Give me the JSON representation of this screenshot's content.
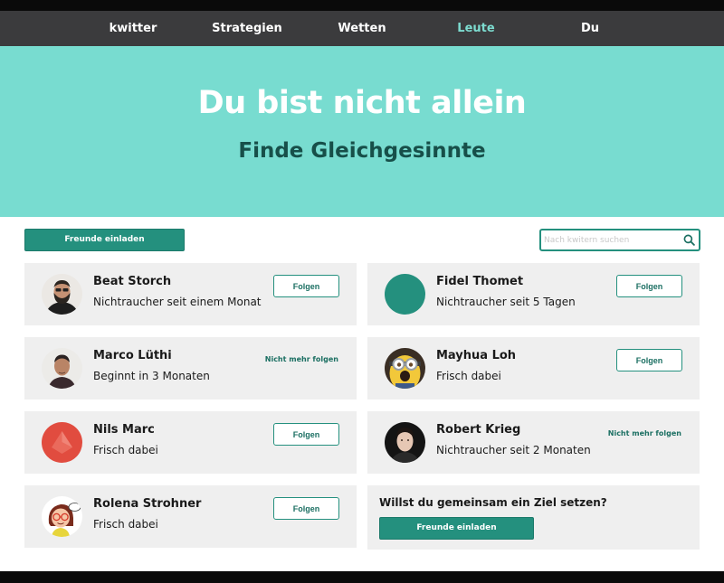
{
  "nav": {
    "items": [
      {
        "label": "kwitter"
      },
      {
        "label": "Strategien"
      },
      {
        "label": "Wetten"
      },
      {
        "label": "Leute",
        "active": true
      },
      {
        "label": "Du"
      }
    ]
  },
  "hero": {
    "title": "Du bist nicht allein",
    "subtitle": "Finde Gleichgesinnte"
  },
  "toolbar": {
    "invite_label": "Freunde einladen",
    "search_placeholder": "Nach kwitern suchen"
  },
  "people": [
    {
      "name": "Beat Storch",
      "status": "Nichtraucher seit einem Monat",
      "action": "Folgen",
      "following": false,
      "avatar": "beard-man-photo"
    },
    {
      "name": "Fidel Thomet",
      "status": "Nichtraucher seit 5 Tagen",
      "action": "Folgen",
      "following": false,
      "avatar": "teal-circle"
    },
    {
      "name": "Marco Lüthi",
      "status": "Beginnt in 3 Monaten",
      "action": "Nicht mehr folgen",
      "following": true,
      "avatar": "man-photo"
    },
    {
      "name": "Mayhua Loh",
      "status": "Frisch dabei",
      "action": "Folgen",
      "following": false,
      "avatar": "minion-photo"
    },
    {
      "name": "Nils Marc",
      "status": "Frisch dabei",
      "action": "Folgen",
      "following": false,
      "avatar": "red-logo-circle"
    },
    {
      "name": "Robert Krieg",
      "status": "Nichtraucher seit 2 Monaten",
      "action": "Nicht mehr folgen",
      "following": true,
      "avatar": "young-man-photo"
    },
    {
      "name": "Rolena Strohner",
      "status": "Frisch dabei",
      "action": "Folgen",
      "following": false,
      "avatar": "cartoon-woman"
    }
  ],
  "goal": {
    "title": "Willst du gemeinsam ein Ziel setzen?",
    "button_label": "Freunde einladen"
  },
  "colors": {
    "accent": "#24907e",
    "hero_bg": "#78dcd0",
    "nav_bg": "#3b3b3d",
    "nav_active": "#7ddcd0",
    "card_bg": "#efefef"
  }
}
